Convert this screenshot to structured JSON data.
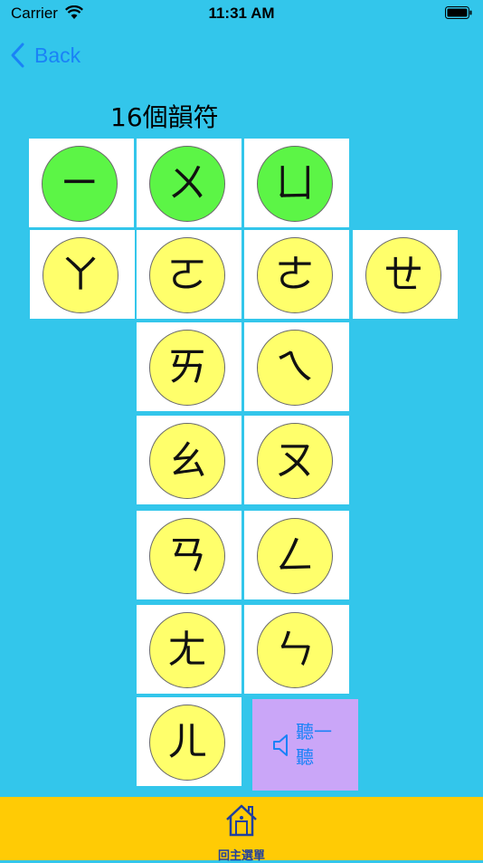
{
  "status_bar": {
    "carrier": "Carrier",
    "time": "11:31 AM"
  },
  "nav": {
    "back_label": "Back"
  },
  "title": "16個韻符",
  "symbols": [
    {
      "char": "ㄧ",
      "color": "green"
    },
    {
      "char": "ㄨ",
      "color": "green"
    },
    {
      "char": "ㄩ",
      "color": "green"
    },
    {
      "char": "ㄚ",
      "color": "yellow"
    },
    {
      "char": "ㄛ",
      "color": "yellow"
    },
    {
      "char": "ㄜ",
      "color": "yellow"
    },
    {
      "char": "ㄝ",
      "color": "yellow"
    },
    {
      "char": "ㄞ",
      "color": "yellow"
    },
    {
      "char": "ㄟ",
      "color": "yellow"
    },
    {
      "char": "ㄠ",
      "color": "yellow"
    },
    {
      "char": "ㄡ",
      "color": "yellow"
    },
    {
      "char": "ㄢ",
      "color": "yellow"
    },
    {
      "char": "ㄥ",
      "color": "yellow"
    },
    {
      "char": "ㄤ",
      "color": "yellow"
    },
    {
      "char": "ㄣ",
      "color": "yellow"
    },
    {
      "char": "ㄦ",
      "color": "yellow"
    }
  ],
  "listen": {
    "label": "聽一聽",
    "icon": "speaker-icon"
  },
  "tab_bar": {
    "home_label": "回主選單",
    "icon": "home-icon"
  },
  "colors": {
    "background": "#33c6eb",
    "green": "#5cf546",
    "yellow": "#ffff6b",
    "listen_bg": "#caa6f8",
    "tab_bg": "#ffcb05",
    "accent": "#1a82f7"
  }
}
